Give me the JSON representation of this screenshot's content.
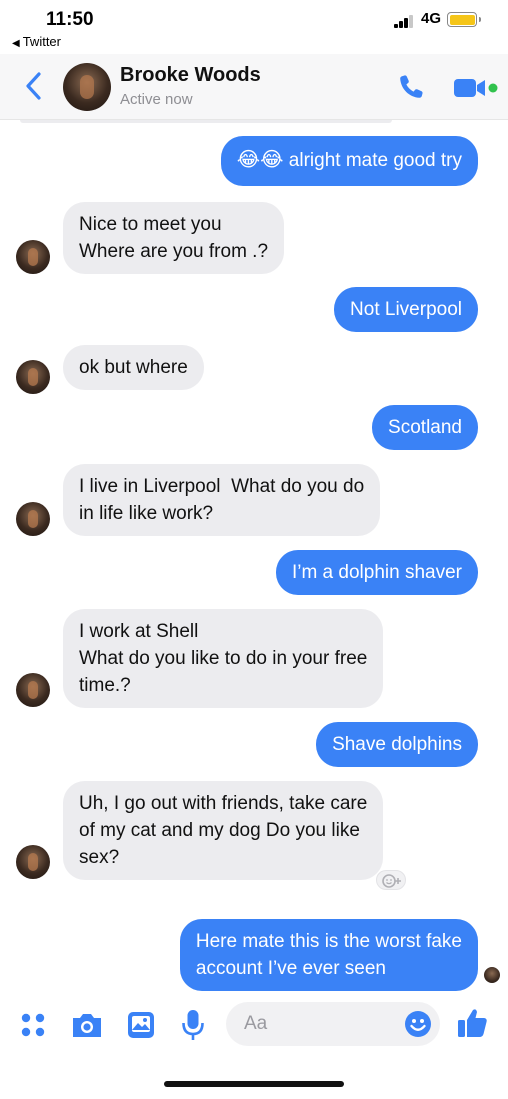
{
  "status_bar": {
    "time": "11:50",
    "back_app": "Twitter",
    "network": "4G"
  },
  "header": {
    "contact_name": "Brooke Woods",
    "contact_status": "Active now"
  },
  "messages": [
    {
      "side": "out",
      "text": "alright mate good try",
      "emoji": "😂😂"
    },
    {
      "side": "in",
      "lines": [
        "Nice to meet you",
        "Where are you from .?"
      ]
    },
    {
      "side": "out",
      "text": "Not Liverpool"
    },
    {
      "side": "in",
      "lines": [
        "ok but where"
      ]
    },
    {
      "side": "out",
      "text": "Scotland"
    },
    {
      "side": "in",
      "lines": [
        "I live in Liverpool  What do you do",
        "in life like work?"
      ]
    },
    {
      "side": "out",
      "text": "I’m a dolphin shaver"
    },
    {
      "side": "in",
      "lines": [
        "I work at Shell",
        "What do you like to do in your free",
        "time.?"
      ]
    },
    {
      "side": "out",
      "text": "Shave dolphins"
    },
    {
      "side": "in",
      "lines": [
        "Uh, I go out with friends, take care",
        "of my cat and my dog Do you like",
        "sex?"
      ]
    },
    {
      "side": "out",
      "lines": [
        "Here mate this is the worst fake",
        "account I’ve ever seen"
      ]
    }
  ],
  "composer": {
    "placeholder": "Aa"
  },
  "colors": {
    "accent": "#3a82f6",
    "incoming_bubble": "#ececef",
    "battery": "#f5c518",
    "online_dot": "#31c24d"
  },
  "icons": [
    "chevron-left-icon",
    "phone-icon",
    "video-camera-icon",
    "menu-dots-icon",
    "camera-icon",
    "image-icon",
    "microphone-icon",
    "emoji-icon",
    "thumbs-up-icon",
    "add-reaction-icon"
  ]
}
